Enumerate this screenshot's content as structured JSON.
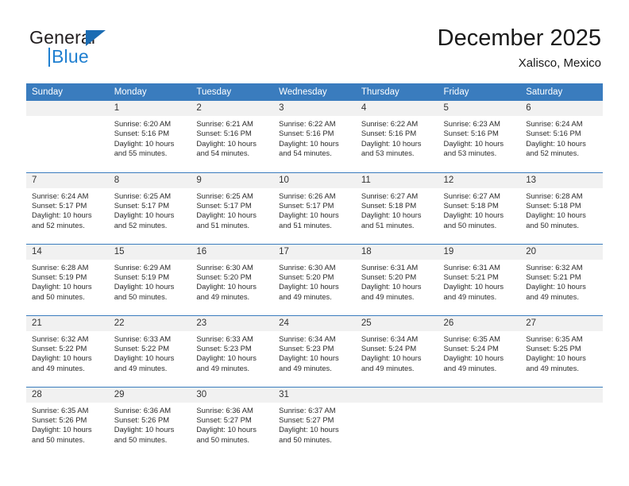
{
  "brand": {
    "name_top": "General",
    "name_bottom": "Blue",
    "accent_blue": "#1f7fd0",
    "triangle_blue": "#1b6cb3"
  },
  "header": {
    "title": "December 2025",
    "subtitle": "Xalisco, Mexico"
  },
  "calendar": {
    "header_bg": "#3a7cbe",
    "header_text_color": "#ffffff",
    "daynum_bg": "#f1f1f1",
    "weekday_headers": [
      "Sunday",
      "Monday",
      "Tuesday",
      "Wednesday",
      "Thursday",
      "Friday",
      "Saturday"
    ],
    "labels": {
      "sunrise": "Sunrise:",
      "sunset": "Sunset:",
      "daylight": "Daylight:"
    },
    "weeks": [
      [
        {
          "day": ""
        },
        {
          "day": "1",
          "sunrise": "Sunrise: 6:20 AM",
          "sunset": "Sunset: 5:16 PM",
          "daylight_line1": "Daylight: 10 hours",
          "daylight_line2": "and 55 minutes."
        },
        {
          "day": "2",
          "sunrise": "Sunrise: 6:21 AM",
          "sunset": "Sunset: 5:16 PM",
          "daylight_line1": "Daylight: 10 hours",
          "daylight_line2": "and 54 minutes."
        },
        {
          "day": "3",
          "sunrise": "Sunrise: 6:22 AM",
          "sunset": "Sunset: 5:16 PM",
          "daylight_line1": "Daylight: 10 hours",
          "daylight_line2": "and 54 minutes."
        },
        {
          "day": "4",
          "sunrise": "Sunrise: 6:22 AM",
          "sunset": "Sunset: 5:16 PM",
          "daylight_line1": "Daylight: 10 hours",
          "daylight_line2": "and 53 minutes."
        },
        {
          "day": "5",
          "sunrise": "Sunrise: 6:23 AM",
          "sunset": "Sunset: 5:16 PM",
          "daylight_line1": "Daylight: 10 hours",
          "daylight_line2": "and 53 minutes."
        },
        {
          "day": "6",
          "sunrise": "Sunrise: 6:24 AM",
          "sunset": "Sunset: 5:16 PM",
          "daylight_line1": "Daylight: 10 hours",
          "daylight_line2": "and 52 minutes."
        }
      ],
      [
        {
          "day": "7",
          "sunrise": "Sunrise: 6:24 AM",
          "sunset": "Sunset: 5:17 PM",
          "daylight_line1": "Daylight: 10 hours",
          "daylight_line2": "and 52 minutes."
        },
        {
          "day": "8",
          "sunrise": "Sunrise: 6:25 AM",
          "sunset": "Sunset: 5:17 PM",
          "daylight_line1": "Daylight: 10 hours",
          "daylight_line2": "and 52 minutes."
        },
        {
          "day": "9",
          "sunrise": "Sunrise: 6:25 AM",
          "sunset": "Sunset: 5:17 PM",
          "daylight_line1": "Daylight: 10 hours",
          "daylight_line2": "and 51 minutes."
        },
        {
          "day": "10",
          "sunrise": "Sunrise: 6:26 AM",
          "sunset": "Sunset: 5:17 PM",
          "daylight_line1": "Daylight: 10 hours",
          "daylight_line2": "and 51 minutes."
        },
        {
          "day": "11",
          "sunrise": "Sunrise: 6:27 AM",
          "sunset": "Sunset: 5:18 PM",
          "daylight_line1": "Daylight: 10 hours",
          "daylight_line2": "and 51 minutes."
        },
        {
          "day": "12",
          "sunrise": "Sunrise: 6:27 AM",
          "sunset": "Sunset: 5:18 PM",
          "daylight_line1": "Daylight: 10 hours",
          "daylight_line2": "and 50 minutes."
        },
        {
          "day": "13",
          "sunrise": "Sunrise: 6:28 AM",
          "sunset": "Sunset: 5:18 PM",
          "daylight_line1": "Daylight: 10 hours",
          "daylight_line2": "and 50 minutes."
        }
      ],
      [
        {
          "day": "14",
          "sunrise": "Sunrise: 6:28 AM",
          "sunset": "Sunset: 5:19 PM",
          "daylight_line1": "Daylight: 10 hours",
          "daylight_line2": "and 50 minutes."
        },
        {
          "day": "15",
          "sunrise": "Sunrise: 6:29 AM",
          "sunset": "Sunset: 5:19 PM",
          "daylight_line1": "Daylight: 10 hours",
          "daylight_line2": "and 50 minutes."
        },
        {
          "day": "16",
          "sunrise": "Sunrise: 6:30 AM",
          "sunset": "Sunset: 5:20 PM",
          "daylight_line1": "Daylight: 10 hours",
          "daylight_line2": "and 49 minutes."
        },
        {
          "day": "17",
          "sunrise": "Sunrise: 6:30 AM",
          "sunset": "Sunset: 5:20 PM",
          "daylight_line1": "Daylight: 10 hours",
          "daylight_line2": "and 49 minutes."
        },
        {
          "day": "18",
          "sunrise": "Sunrise: 6:31 AM",
          "sunset": "Sunset: 5:20 PM",
          "daylight_line1": "Daylight: 10 hours",
          "daylight_line2": "and 49 minutes."
        },
        {
          "day": "19",
          "sunrise": "Sunrise: 6:31 AM",
          "sunset": "Sunset: 5:21 PM",
          "daylight_line1": "Daylight: 10 hours",
          "daylight_line2": "and 49 minutes."
        },
        {
          "day": "20",
          "sunrise": "Sunrise: 6:32 AM",
          "sunset": "Sunset: 5:21 PM",
          "daylight_line1": "Daylight: 10 hours",
          "daylight_line2": "and 49 minutes."
        }
      ],
      [
        {
          "day": "21",
          "sunrise": "Sunrise: 6:32 AM",
          "sunset": "Sunset: 5:22 PM",
          "daylight_line1": "Daylight: 10 hours",
          "daylight_line2": "and 49 minutes."
        },
        {
          "day": "22",
          "sunrise": "Sunrise: 6:33 AM",
          "sunset": "Sunset: 5:22 PM",
          "daylight_line1": "Daylight: 10 hours",
          "daylight_line2": "and 49 minutes."
        },
        {
          "day": "23",
          "sunrise": "Sunrise: 6:33 AM",
          "sunset": "Sunset: 5:23 PM",
          "daylight_line1": "Daylight: 10 hours",
          "daylight_line2": "and 49 minutes."
        },
        {
          "day": "24",
          "sunrise": "Sunrise: 6:34 AM",
          "sunset": "Sunset: 5:23 PM",
          "daylight_line1": "Daylight: 10 hours",
          "daylight_line2": "and 49 minutes."
        },
        {
          "day": "25",
          "sunrise": "Sunrise: 6:34 AM",
          "sunset": "Sunset: 5:24 PM",
          "daylight_line1": "Daylight: 10 hours",
          "daylight_line2": "and 49 minutes."
        },
        {
          "day": "26",
          "sunrise": "Sunrise: 6:35 AM",
          "sunset": "Sunset: 5:24 PM",
          "daylight_line1": "Daylight: 10 hours",
          "daylight_line2": "and 49 minutes."
        },
        {
          "day": "27",
          "sunrise": "Sunrise: 6:35 AM",
          "sunset": "Sunset: 5:25 PM",
          "daylight_line1": "Daylight: 10 hours",
          "daylight_line2": "and 49 minutes."
        }
      ],
      [
        {
          "day": "28",
          "sunrise": "Sunrise: 6:35 AM",
          "sunset": "Sunset: 5:26 PM",
          "daylight_line1": "Daylight: 10 hours",
          "daylight_line2": "and 50 minutes."
        },
        {
          "day": "29",
          "sunrise": "Sunrise: 6:36 AM",
          "sunset": "Sunset: 5:26 PM",
          "daylight_line1": "Daylight: 10 hours",
          "daylight_line2": "and 50 minutes."
        },
        {
          "day": "30",
          "sunrise": "Sunrise: 6:36 AM",
          "sunset": "Sunset: 5:27 PM",
          "daylight_line1": "Daylight: 10 hours",
          "daylight_line2": "and 50 minutes."
        },
        {
          "day": "31",
          "sunrise": "Sunrise: 6:37 AM",
          "sunset": "Sunset: 5:27 PM",
          "daylight_line1": "Daylight: 10 hours",
          "daylight_line2": "and 50 minutes."
        },
        {
          "day": ""
        },
        {
          "day": ""
        },
        {
          "day": ""
        }
      ]
    ]
  }
}
